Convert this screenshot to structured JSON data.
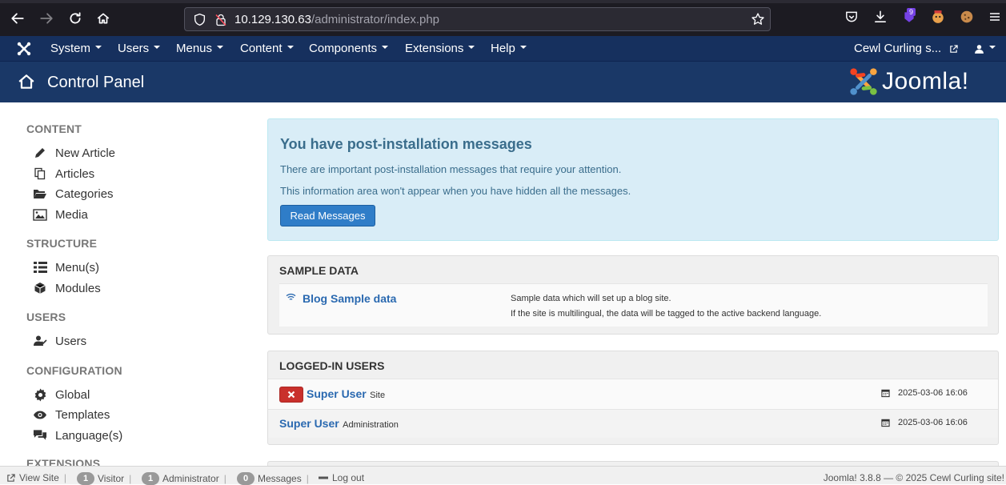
{
  "browser": {
    "url_host": "10.129.130.63",
    "url_path": "/administrator/index.php",
    "extension_badge": "9"
  },
  "topnav": {
    "menus": [
      {
        "label": "System"
      },
      {
        "label": "Users"
      },
      {
        "label": "Menus"
      },
      {
        "label": "Content"
      },
      {
        "label": "Components"
      },
      {
        "label": "Extensions"
      },
      {
        "label": "Help"
      }
    ],
    "site_link": "Cewl Curling s..."
  },
  "header": {
    "title": "Control Panel",
    "brand": "Joomla!"
  },
  "sidebar": {
    "sections": [
      {
        "heading": "CONTENT",
        "items": [
          {
            "label": "New Article",
            "icon": "pencil-icon"
          },
          {
            "label": "Articles",
            "icon": "copy-icon"
          },
          {
            "label": "Categories",
            "icon": "folder-open-icon"
          },
          {
            "label": "Media",
            "icon": "image-icon"
          }
        ]
      },
      {
        "heading": "STRUCTURE",
        "items": [
          {
            "label": "Menu(s)",
            "icon": "list-icon"
          },
          {
            "label": "Modules",
            "icon": "cube-icon"
          }
        ]
      },
      {
        "heading": "USERS",
        "items": [
          {
            "label": "Users",
            "icon": "users-icon"
          }
        ]
      },
      {
        "heading": "CONFIGURATION",
        "items": [
          {
            "label": "Global",
            "icon": "cog-icon"
          },
          {
            "label": "Templates",
            "icon": "eye-icon"
          },
          {
            "label": "Language(s)",
            "icon": "comments-icon"
          }
        ]
      },
      {
        "heading": "EXTENSIONS",
        "items": []
      }
    ]
  },
  "postinstall": {
    "title": "You have post-installation messages",
    "line1": "There are important post-installation messages that require your attention.",
    "line2": "This information area won't appear when you have hidden all the messages.",
    "button": "Read Messages"
  },
  "sample_data": {
    "title": "SAMPLE DATA",
    "item_label": "Blog Sample data",
    "desc1": "Sample data which will set up a blog site.",
    "desc2": "If the site is multilingual, the data will be tagged to the active backend language."
  },
  "logged_in": {
    "title": "LOGGED-IN USERS",
    "rows": [
      {
        "name": "Super User",
        "client": "Site",
        "time": "2025-03-06 16:06",
        "logout": true
      },
      {
        "name": "Super User",
        "client": "Administration",
        "time": "2025-03-06 16:06",
        "logout": false
      }
    ]
  },
  "footer": {
    "view_site": "View Site",
    "visitor_count": "1",
    "visitor_label": "Visitor",
    "admin_count": "1",
    "admin_label": "Administrator",
    "messages_count": "0",
    "messages_label": "Messages",
    "logout": "Log out",
    "copyright": "Joomla! 3.8.8  —  © 2025 Cewl Curling site!"
  },
  "colors": {
    "topnav_bg": "#16305e",
    "header_bg": "#1a3867",
    "alert_bg": "#d9edf7",
    "primary": "#2f7dc8",
    "link": "#2a69b0",
    "danger": "#c9302c"
  }
}
